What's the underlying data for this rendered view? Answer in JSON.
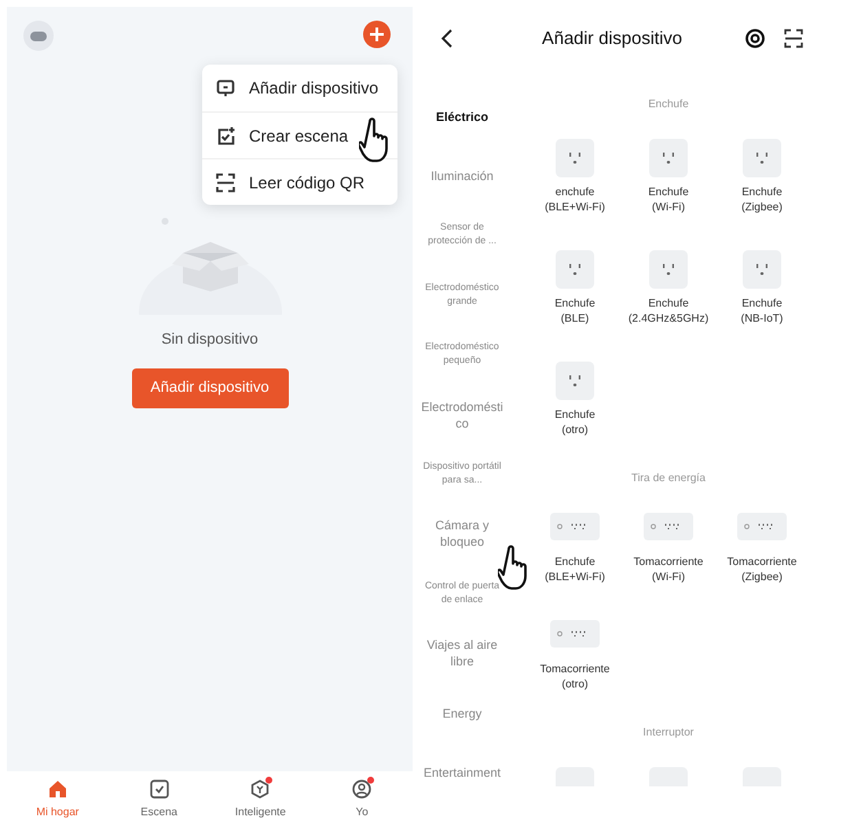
{
  "home": {
    "menu": [
      {
        "kind": "device",
        "label": "Añadir dispositivo"
      },
      {
        "kind": "scene",
        "label": "Crear escena"
      },
      {
        "kind": "qr",
        "label": "Leer código QR"
      }
    ],
    "empty_text": "Sin dispositivo",
    "add_button": "Añadir dispositivo",
    "nav": [
      {
        "kind": "home",
        "label": "Mi hogar",
        "selected": true,
        "badge": false
      },
      {
        "kind": "scene",
        "label": "Escena",
        "selected": false,
        "badge": false
      },
      {
        "kind": "smart",
        "label": "Inteligente",
        "selected": false,
        "badge": true
      },
      {
        "kind": "me",
        "label": "Yo",
        "selected": false,
        "badge": true
      }
    ]
  },
  "add_device": {
    "title": "Añadir dispositivo",
    "categories": [
      {
        "label": "Eléctrico",
        "kind": "normal",
        "selected": true
      },
      {
        "label": "Iluminación",
        "kind": "normal",
        "selected": false
      },
      {
        "label": "Sensor de protección de ...",
        "kind": "small",
        "selected": false
      },
      {
        "label": "Electrodoméstico grande",
        "kind": "small",
        "selected": false
      },
      {
        "label": "Electrodoméstico pequeño",
        "kind": "small",
        "selected": false
      },
      {
        "label": "Electrodoméstico",
        "kind": "normal",
        "selected": false
      },
      {
        "label": "Dispositivo portátil para sa...",
        "kind": "small",
        "selected": false
      },
      {
        "label": "Cámara y bloqueo",
        "kind": "normal",
        "selected": false
      },
      {
        "label": "Control de puerta de enlace",
        "kind": "small",
        "selected": false
      },
      {
        "label": "Viajes al aire libre",
        "kind": "normal",
        "selected": false
      },
      {
        "label": "Energy",
        "kind": "normal",
        "selected": false
      },
      {
        "label": "Entertainment",
        "kind": "normal",
        "selected": false
      }
    ],
    "sections": [
      {
        "title": "Enchufe",
        "items": [
          {
            "kind": "outlet",
            "name": "enchufe",
            "variant": "(BLE+Wi-Fi)"
          },
          {
            "kind": "outlet",
            "name": "Enchufe",
            "variant": "(Wi-Fi)"
          },
          {
            "kind": "outlet",
            "name": "Enchufe",
            "variant": "(Zigbee)"
          },
          {
            "kind": "outlet",
            "name": "Enchufe",
            "variant": "(BLE)"
          },
          {
            "kind": "outlet",
            "name": "Enchufe",
            "variant": "(2.4GHz&5GHz)"
          },
          {
            "kind": "outlet",
            "name": "Enchufe",
            "variant": "(NB-IoT)"
          },
          {
            "kind": "outlet",
            "name": "Enchufe",
            "variant": "(otro)"
          }
        ]
      },
      {
        "title": "Tira de energía",
        "items": [
          {
            "kind": "strip",
            "name": "Enchufe",
            "variant": "(BLE+Wi-Fi)"
          },
          {
            "kind": "strip",
            "name": "Tomacorriente",
            "variant": "(Wi-Fi)"
          },
          {
            "kind": "strip",
            "name": "Tomacorriente",
            "variant": "(Zigbee)"
          },
          {
            "kind": "strip",
            "name": "Tomacorriente",
            "variant": "(otro)"
          }
        ]
      },
      {
        "title": "Interruptor",
        "items": [
          {
            "kind": "switch"
          },
          {
            "kind": "switch"
          },
          {
            "kind": "switch"
          }
        ]
      }
    ]
  }
}
